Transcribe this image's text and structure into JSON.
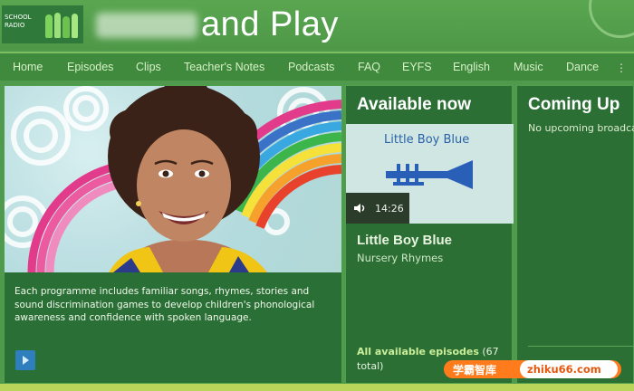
{
  "header": {
    "logo_text_line1": "SCHOOL",
    "logo_text_line2": "RADIO",
    "title": "and Play"
  },
  "nav": {
    "items": [
      "Home",
      "Episodes",
      "Clips",
      "Teacher's Notes",
      "Podcasts",
      "FAQ",
      "EYFS",
      "English",
      "Music",
      "Dance"
    ]
  },
  "hero": {
    "description": "Each programme includes familiar songs, rhymes, stories and sound discrimination games to develop children's phonological awareness and confidence with spoken language."
  },
  "available_now": {
    "heading": "Available now",
    "thumb_title": "Little Boy Blue",
    "duration": "14:26",
    "episode_title": "Little Boy Blue",
    "episode_subtitle": "Nursery Rhymes",
    "all_link": "All available episodes",
    "all_count": "(67 total)"
  },
  "coming_up": {
    "heading": "Coming Up",
    "none_text": "No upcoming broadcasts"
  },
  "watermark": {
    "cn_text": "学霸智库",
    "url": "zhiku66.com"
  },
  "colors": {
    "header_bg": "#5aa650",
    "nav_bg": "#3f8a3c",
    "panel_bg": "#2b6f35",
    "accent_link": "#cbee9a",
    "watermark_orange": "#ff7b1c"
  }
}
